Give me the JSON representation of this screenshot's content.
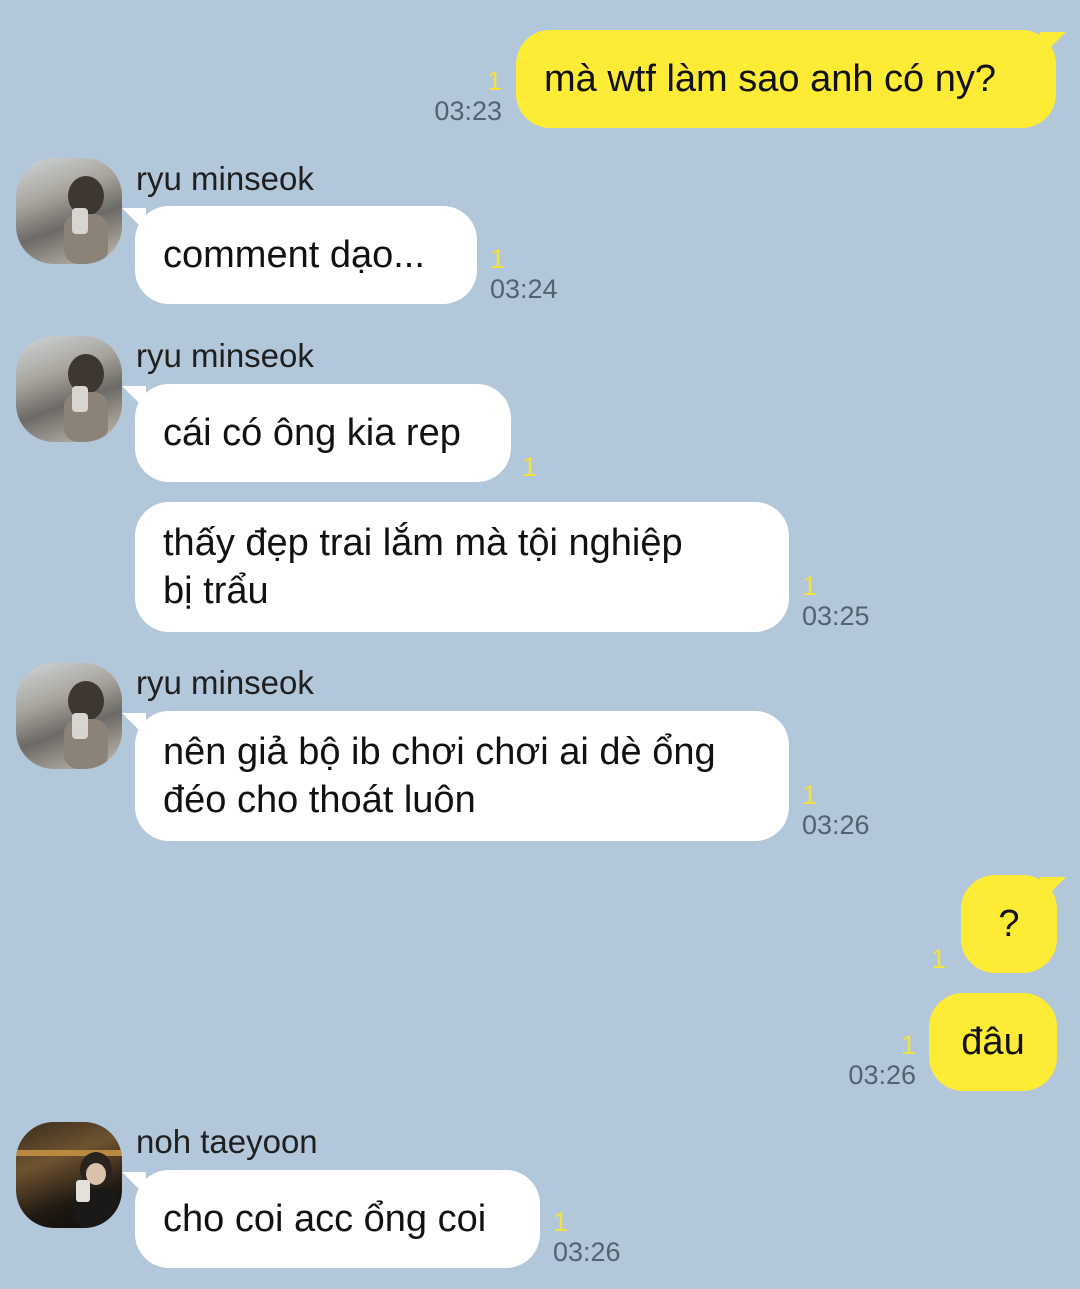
{
  "messages": {
    "m1": {
      "text": "mà wtf làm sao anh có ny?",
      "unread": "1",
      "time": "03:23"
    },
    "group1": {
      "sender": "ryu minseok"
    },
    "m2": {
      "text": "comment dạo...",
      "unread": "1",
      "time": "03:24"
    },
    "group2": {
      "sender": "ryu minseok"
    },
    "m3": {
      "text": "cái có ông kia rep",
      "unread": "1"
    },
    "m4": {
      "line1": "thấy đẹp trai lắm mà tội nghiệp",
      "line2": "bị trẩu",
      "unread": "1",
      "time": "03:25"
    },
    "group3": {
      "sender": "ryu minseok"
    },
    "m5": {
      "line1": "nên giả bộ ib chơi chơi ai dè ổng",
      "line2": "đéo cho thoát luôn",
      "unread": "1",
      "time": "03:26"
    },
    "m6": {
      "text": "?",
      "unread": "1"
    },
    "m7": {
      "text": "đâu",
      "unread": "1",
      "time": "03:26"
    },
    "group4": {
      "sender": "noh taeyoon"
    },
    "m8": {
      "text": "cho coi acc ổng coi",
      "unread": "1",
      "time": "03:26"
    }
  },
  "colors": {
    "background": "#b2c7d9",
    "outgoing_bubble": "#fdeb36",
    "incoming_bubble": "#ffffff",
    "unread_count": "#f2e23f",
    "timestamp": "#556270"
  },
  "icons": {
    "avatar_ryu": "avatar-photo",
    "avatar_noh": "avatar-photo"
  }
}
